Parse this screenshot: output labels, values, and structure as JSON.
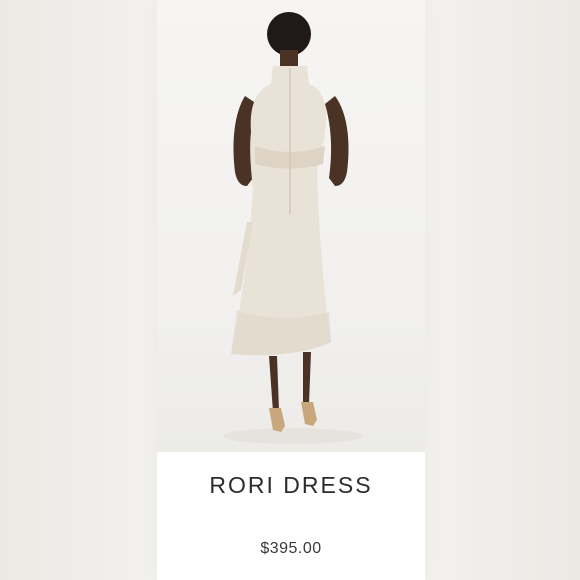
{
  "product": {
    "name": "RORI DRESS",
    "price": "$395.00",
    "image_icon": "product-photo"
  }
}
